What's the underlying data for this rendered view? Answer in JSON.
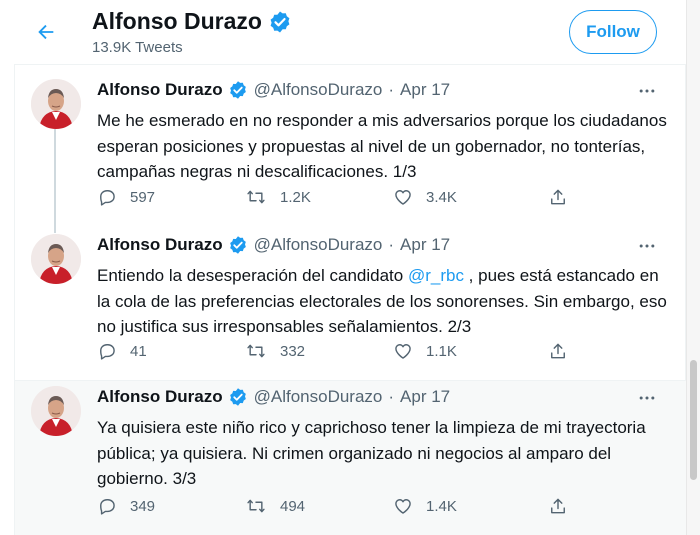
{
  "header": {
    "name": "Alfonso Durazo",
    "tweet_count": "13.9K Tweets",
    "follow_label": "Follow",
    "back_icon": "arrow-left-icon"
  },
  "colors": {
    "accent": "#1d9bf0",
    "secondary_text": "#536471",
    "primary_text": "#0f1419",
    "highlight_bg": "#f7f9f9"
  },
  "tweets": [
    {
      "name": "Alfonso Durazo",
      "handle": "@AlfonsoDurazo",
      "dot": "·",
      "date": "Apr 17",
      "text": "Me he esmerado en no responder a mis adversarios porque los ciudadanos esperan posiciones y propuestas al nivel de un gobernador, no tonterías, campañas negras ni descalificaciones. 1/3",
      "replies": "597",
      "retweets": "1.2K",
      "likes": "3.4K"
    },
    {
      "name": "Alfonso Durazo",
      "handle": "@AlfonsoDurazo",
      "dot": "·",
      "date": "Apr 17",
      "text_before": "Entiendo la desesperación del candidato ",
      "mention": "@r_rbc",
      "text_after": " , pues está estancado en la cola de las preferencias electorales de los sonorenses. Sin embargo, eso no justifica sus irresponsables señalamientos. 2/3",
      "replies": "41",
      "retweets": "332",
      "likes": "1.1K"
    },
    {
      "name": "Alfonso Durazo",
      "handle": "@AlfonsoDurazo",
      "dot": "·",
      "date": "Apr 17",
      "text": "Ya quisiera este niño rico y caprichoso tener la limpieza de mi trayectoria pública; ya quisiera. Ni crimen organizado ni negocios al amparo del gobierno. 3/3",
      "replies": "349",
      "retweets": "494",
      "likes": "1.4K"
    }
  ]
}
